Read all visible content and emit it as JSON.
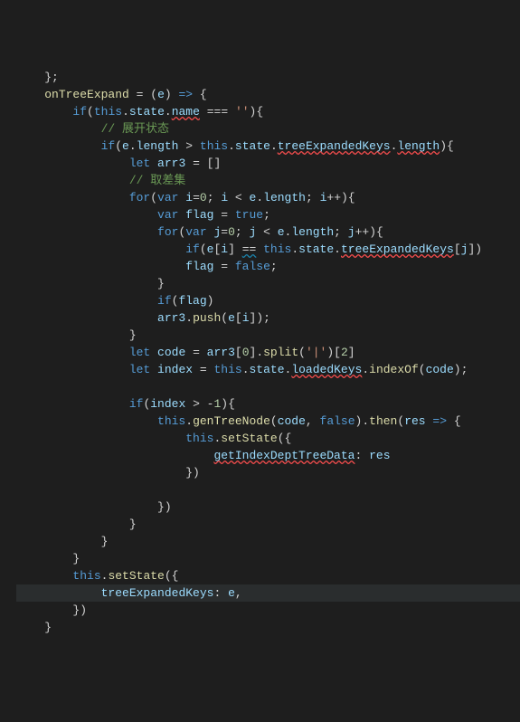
{
  "lines": [
    {
      "indent": 1,
      "segs": [
        {
          "t": "};",
          "c": "pun"
        }
      ]
    },
    {
      "indent": 1,
      "segs": [
        {
          "t": "onTreeExpand",
          "c": "fn"
        },
        {
          "t": " = (",
          "c": "pun"
        },
        {
          "t": "e",
          "c": "var"
        },
        {
          "t": ") ",
          "c": "pun"
        },
        {
          "t": "=>",
          "c": "kw"
        },
        {
          "t": " {",
          "c": "pun"
        }
      ]
    },
    {
      "indent": 2,
      "segs": [
        {
          "t": "if",
          "c": "kw"
        },
        {
          "t": "(",
          "c": "pun"
        },
        {
          "t": "this",
          "c": "this"
        },
        {
          "t": ".",
          "c": "pun"
        },
        {
          "t": "state",
          "c": "var"
        },
        {
          "t": ".",
          "c": "pun"
        },
        {
          "t": "name",
          "c": "var err"
        },
        {
          "t": " === ",
          "c": "pun"
        },
        {
          "t": "''",
          "c": "str"
        },
        {
          "t": "){",
          "c": "pun"
        }
      ]
    },
    {
      "indent": 3,
      "segs": [
        {
          "t": "// 展开状态",
          "c": "cmt"
        }
      ]
    },
    {
      "indent": 3,
      "segs": [
        {
          "t": "if",
          "c": "kw"
        },
        {
          "t": "(",
          "c": "pun"
        },
        {
          "t": "e",
          "c": "var"
        },
        {
          "t": ".",
          "c": "pun"
        },
        {
          "t": "length",
          "c": "var"
        },
        {
          "t": " > ",
          "c": "pun"
        },
        {
          "t": "this",
          "c": "this"
        },
        {
          "t": ".",
          "c": "pun"
        },
        {
          "t": "state",
          "c": "var"
        },
        {
          "t": ".",
          "c": "pun"
        },
        {
          "t": "treeExpandedKeys",
          "c": "var err"
        },
        {
          "t": ".",
          "c": "pun"
        },
        {
          "t": "length",
          "c": "var err"
        },
        {
          "t": "){",
          "c": "pun"
        }
      ]
    },
    {
      "indent": 4,
      "segs": [
        {
          "t": "let",
          "c": "kw"
        },
        {
          "t": " ",
          "c": "pun"
        },
        {
          "t": "arr3",
          "c": "var"
        },
        {
          "t": " = []",
          "c": "pun"
        }
      ]
    },
    {
      "indent": 4,
      "segs": [
        {
          "t": "// 取差集",
          "c": "cmt"
        }
      ]
    },
    {
      "indent": 4,
      "segs": [
        {
          "t": "for",
          "c": "kw"
        },
        {
          "t": "(",
          "c": "pun"
        },
        {
          "t": "var",
          "c": "kw"
        },
        {
          "t": " ",
          "c": "pun"
        },
        {
          "t": "i",
          "c": "var"
        },
        {
          "t": "=",
          "c": "pun"
        },
        {
          "t": "0",
          "c": "num"
        },
        {
          "t": "; ",
          "c": "pun"
        },
        {
          "t": "i",
          "c": "var"
        },
        {
          "t": " < ",
          "c": "pun"
        },
        {
          "t": "e",
          "c": "var"
        },
        {
          "t": ".",
          "c": "pun"
        },
        {
          "t": "length",
          "c": "var"
        },
        {
          "t": "; ",
          "c": "pun"
        },
        {
          "t": "i",
          "c": "var"
        },
        {
          "t": "++){",
          "c": "pun"
        }
      ]
    },
    {
      "indent": 5,
      "segs": [
        {
          "t": "var",
          "c": "kw"
        },
        {
          "t": " ",
          "c": "pun"
        },
        {
          "t": "flag",
          "c": "var"
        },
        {
          "t": " = ",
          "c": "pun"
        },
        {
          "t": "true",
          "c": "const"
        },
        {
          "t": ";",
          "c": "pun"
        }
      ]
    },
    {
      "indent": 5,
      "segs": [
        {
          "t": "for",
          "c": "kw"
        },
        {
          "t": "(",
          "c": "pun"
        },
        {
          "t": "var",
          "c": "kw"
        },
        {
          "t": " ",
          "c": "pun"
        },
        {
          "t": "j",
          "c": "var"
        },
        {
          "t": "=",
          "c": "pun"
        },
        {
          "t": "0",
          "c": "num"
        },
        {
          "t": "; ",
          "c": "pun"
        },
        {
          "t": "j",
          "c": "var"
        },
        {
          "t": " < ",
          "c": "pun"
        },
        {
          "t": "e",
          "c": "var"
        },
        {
          "t": ".",
          "c": "pun"
        },
        {
          "t": "length",
          "c": "var"
        },
        {
          "t": "; ",
          "c": "pun"
        },
        {
          "t": "j",
          "c": "var"
        },
        {
          "t": "++){",
          "c": "pun"
        }
      ]
    },
    {
      "indent": 6,
      "segs": [
        {
          "t": "if",
          "c": "kw"
        },
        {
          "t": "(",
          "c": "pun"
        },
        {
          "t": "e",
          "c": "var"
        },
        {
          "t": "[",
          "c": "pun"
        },
        {
          "t": "i",
          "c": "var"
        },
        {
          "t": "] ",
          "c": "pun"
        },
        {
          "t": "==",
          "c": "pun info"
        },
        {
          "t": " ",
          "c": "pun"
        },
        {
          "t": "this",
          "c": "this"
        },
        {
          "t": ".",
          "c": "pun"
        },
        {
          "t": "state",
          "c": "var"
        },
        {
          "t": ".",
          "c": "pun"
        },
        {
          "t": "treeExpandedKeys",
          "c": "var err"
        },
        {
          "t": "[",
          "c": "pun"
        },
        {
          "t": "j",
          "c": "var"
        },
        {
          "t": "])",
          "c": "pun"
        }
      ]
    },
    {
      "indent": 6,
      "segs": [
        {
          "t": "flag",
          "c": "var"
        },
        {
          "t": " = ",
          "c": "pun"
        },
        {
          "t": "false",
          "c": "const"
        },
        {
          "t": ";",
          "c": "pun"
        }
      ]
    },
    {
      "indent": 5,
      "segs": [
        {
          "t": "}",
          "c": "pun"
        }
      ]
    },
    {
      "indent": 5,
      "segs": [
        {
          "t": "if",
          "c": "kw"
        },
        {
          "t": "(",
          "c": "pun"
        },
        {
          "t": "flag",
          "c": "var"
        },
        {
          "t": ")",
          "c": "pun"
        }
      ]
    },
    {
      "indent": 5,
      "segs": [
        {
          "t": "arr3",
          "c": "var"
        },
        {
          "t": ".",
          "c": "pun"
        },
        {
          "t": "push",
          "c": "fn"
        },
        {
          "t": "(",
          "c": "pun"
        },
        {
          "t": "e",
          "c": "var"
        },
        {
          "t": "[",
          "c": "pun"
        },
        {
          "t": "i",
          "c": "var"
        },
        {
          "t": "]);",
          "c": "pun"
        }
      ]
    },
    {
      "indent": 4,
      "segs": [
        {
          "t": "}",
          "c": "pun"
        }
      ]
    },
    {
      "indent": 4,
      "segs": [
        {
          "t": "let",
          "c": "kw"
        },
        {
          "t": " ",
          "c": "pun"
        },
        {
          "t": "code",
          "c": "var"
        },
        {
          "t": " = ",
          "c": "pun"
        },
        {
          "t": "arr3",
          "c": "var"
        },
        {
          "t": "[",
          "c": "pun"
        },
        {
          "t": "0",
          "c": "num"
        },
        {
          "t": "].",
          "c": "pun"
        },
        {
          "t": "split",
          "c": "fn"
        },
        {
          "t": "(",
          "c": "pun"
        },
        {
          "t": "'|'",
          "c": "str"
        },
        {
          "t": ")[",
          "c": "pun"
        },
        {
          "t": "2",
          "c": "num"
        },
        {
          "t": "]",
          "c": "pun"
        }
      ]
    },
    {
      "indent": 4,
      "segs": [
        {
          "t": "let",
          "c": "kw"
        },
        {
          "t": " ",
          "c": "pun"
        },
        {
          "t": "index",
          "c": "var"
        },
        {
          "t": " = ",
          "c": "pun"
        },
        {
          "t": "this",
          "c": "this"
        },
        {
          "t": ".",
          "c": "pun"
        },
        {
          "t": "state",
          "c": "var"
        },
        {
          "t": ".",
          "c": "pun"
        },
        {
          "t": "loadedKeys",
          "c": "var err"
        },
        {
          "t": ".",
          "c": "pun"
        },
        {
          "t": "indexOf",
          "c": "fn"
        },
        {
          "t": "(",
          "c": "pun"
        },
        {
          "t": "code",
          "c": "var"
        },
        {
          "t": ");",
          "c": "pun"
        }
      ]
    },
    {
      "indent": 0,
      "segs": [
        {
          "t": "",
          "c": "pun"
        }
      ]
    },
    {
      "indent": 4,
      "segs": [
        {
          "t": "if",
          "c": "kw"
        },
        {
          "t": "(",
          "c": "pun"
        },
        {
          "t": "index",
          "c": "var"
        },
        {
          "t": " > -",
          "c": "pun"
        },
        {
          "t": "1",
          "c": "num"
        },
        {
          "t": "){",
          "c": "pun"
        }
      ]
    },
    {
      "indent": 5,
      "segs": [
        {
          "t": "this",
          "c": "this"
        },
        {
          "t": ".",
          "c": "pun"
        },
        {
          "t": "genTreeNode",
          "c": "fn"
        },
        {
          "t": "(",
          "c": "pun"
        },
        {
          "t": "code",
          "c": "var"
        },
        {
          "t": ", ",
          "c": "pun"
        },
        {
          "t": "false",
          "c": "const"
        },
        {
          "t": ").",
          "c": "pun"
        },
        {
          "t": "then",
          "c": "fn"
        },
        {
          "t": "(",
          "c": "pun"
        },
        {
          "t": "res",
          "c": "var"
        },
        {
          "t": " ",
          "c": "pun"
        },
        {
          "t": "=>",
          "c": "kw"
        },
        {
          "t": " {",
          "c": "pun"
        }
      ]
    },
    {
      "indent": 6,
      "segs": [
        {
          "t": "this",
          "c": "this"
        },
        {
          "t": ".",
          "c": "pun"
        },
        {
          "t": "setState",
          "c": "fn"
        },
        {
          "t": "({",
          "c": "pun"
        }
      ]
    },
    {
      "indent": 7,
      "segs": [
        {
          "t": "getIndexDeptTreeData",
          "c": "var err"
        },
        {
          "t": ":",
          "c": "pun"
        },
        {
          "t": " ",
          "c": "pun"
        },
        {
          "t": "res",
          "c": "var"
        }
      ]
    },
    {
      "indent": 6,
      "segs": [
        {
          "t": "})",
          "c": "pun"
        }
      ]
    },
    {
      "indent": 0,
      "segs": [
        {
          "t": "",
          "c": "pun"
        }
      ]
    },
    {
      "indent": 5,
      "segs": [
        {
          "t": "})",
          "c": "pun"
        }
      ]
    },
    {
      "indent": 4,
      "segs": [
        {
          "t": "}",
          "c": "pun"
        }
      ]
    },
    {
      "indent": 3,
      "segs": [
        {
          "t": "}",
          "c": "pun"
        }
      ]
    },
    {
      "indent": 2,
      "segs": [
        {
          "t": "}",
          "c": "pun"
        }
      ]
    },
    {
      "indent": 2,
      "segs": [
        {
          "t": "this",
          "c": "this"
        },
        {
          "t": ".",
          "c": "pun"
        },
        {
          "t": "setState",
          "c": "fn"
        },
        {
          "t": "({",
          "c": "pun"
        }
      ]
    },
    {
      "indent": 3,
      "hl": true,
      "segs": [
        {
          "t": "treeExpandedKeys",
          "c": "var"
        },
        {
          "t": ":",
          "c": "pun"
        },
        {
          "t": " ",
          "c": "pun"
        },
        {
          "t": "e",
          "c": "var"
        },
        {
          "t": ",",
          "c": "pun"
        }
      ]
    },
    {
      "indent": 2,
      "segs": [
        {
          "t": "})",
          "c": "pun"
        }
      ]
    },
    {
      "indent": 1,
      "segs": [
        {
          "t": "}",
          "c": "pun"
        }
      ]
    }
  ]
}
